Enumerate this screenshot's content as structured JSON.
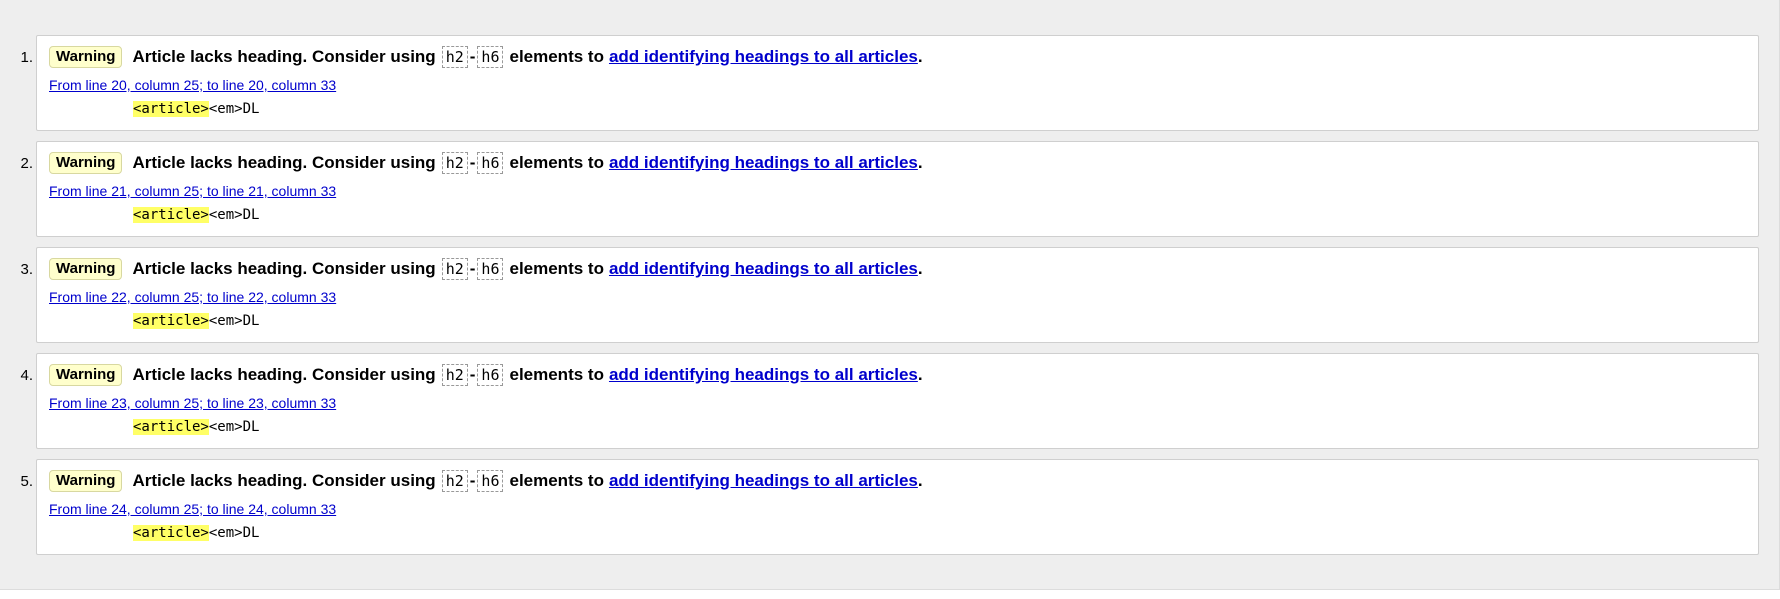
{
  "messages": [
    {
      "number": "1.",
      "type": "Warning",
      "text_before": "Article lacks heading. Consider using",
      "code_start": "h2",
      "dash": "-",
      "code_end": "h6",
      "text_after": "elements to",
      "link_text": "add identifying headings to all articles",
      "period": ".",
      "location": "From line 20, column 25; to line 20, column 33",
      "extract_highlight": "<article>",
      "extract_rest": "<em>DL"
    },
    {
      "number": "2.",
      "type": "Warning",
      "text_before": "Article lacks heading. Consider using",
      "code_start": "h2",
      "dash": "-",
      "code_end": "h6",
      "text_after": "elements to",
      "link_text": "add identifying headings to all articles",
      "period": ".",
      "location": "From line 21, column 25; to line 21, column 33",
      "extract_highlight": "<article>",
      "extract_rest": "<em>DL"
    },
    {
      "number": "3.",
      "type": "Warning",
      "text_before": "Article lacks heading. Consider using",
      "code_start": "h2",
      "dash": "-",
      "code_end": "h6",
      "text_after": "elements to",
      "link_text": "add identifying headings to all articles",
      "period": ".",
      "location": "From line 22, column 25; to line 22, column 33",
      "extract_highlight": "<article>",
      "extract_rest": "<em>DL"
    },
    {
      "number": "4.",
      "type": "Warning",
      "text_before": "Article lacks heading. Consider using",
      "code_start": "h2",
      "dash": "-",
      "code_end": "h6",
      "text_after": "elements to",
      "link_text": "add identifying headings to all articles",
      "period": ".",
      "location": "From line 23, column 25; to line 23, column 33",
      "extract_highlight": "<article>",
      "extract_rest": "<em>DL"
    },
    {
      "number": "5.",
      "type": "Warning",
      "text_before": "Article lacks heading. Consider using",
      "code_start": "h2",
      "dash": "-",
      "code_end": "h6",
      "text_after": "elements to",
      "link_text": "add identifying headings to all articles",
      "period": ".",
      "location": "From line 24, column 25; to line 24, column 33",
      "extract_highlight": "<article>",
      "extract_rest": "<em>DL"
    }
  ],
  "colors": {
    "panel_background": "#eeeeee",
    "warning_badge": "#ffffcc",
    "link": "#0000cc",
    "highlight": "#ffff66"
  }
}
